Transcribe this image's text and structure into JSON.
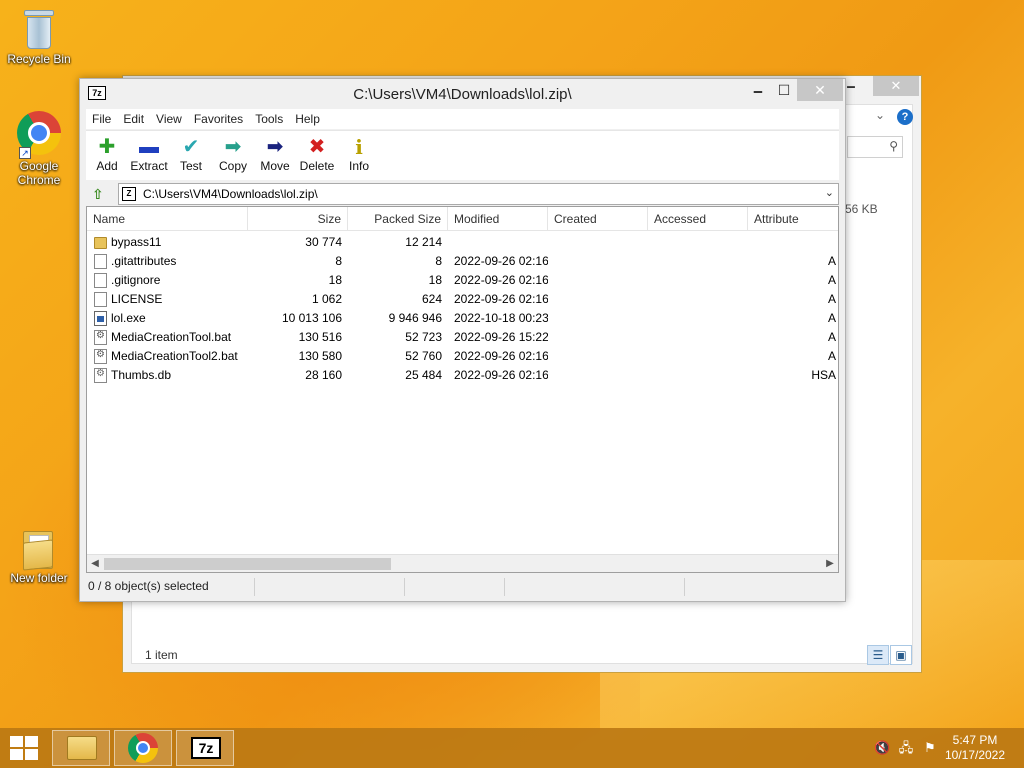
{
  "desktop": {
    "icons": [
      {
        "label": "Recycle Bin"
      },
      {
        "label": "Google Chrome"
      },
      {
        "label": "New folder"
      }
    ]
  },
  "explorer_bg": {
    "size_label": "56 KB",
    "status": "1 item",
    "help": "?"
  },
  "window": {
    "title": "C:\\Users\\VM4\\Downloads\\lol.zip\\",
    "app_icon": "7z",
    "min_glyph": "🗕",
    "max_glyph": "☐",
    "close_glyph": "✕"
  },
  "menu": [
    "File",
    "Edit",
    "View",
    "Favorites",
    "Tools",
    "Help"
  ],
  "toolbar": [
    {
      "label": "Add",
      "icon": "plus-icon",
      "glyph": "✚",
      "color": "#2ca02c"
    },
    {
      "label": "Extract",
      "icon": "minus-icon",
      "glyph": "▬",
      "color": "#1f3fbf"
    },
    {
      "label": "Test",
      "icon": "check-icon",
      "glyph": "✔",
      "color": "#2aa7b0"
    },
    {
      "label": "Copy",
      "icon": "copy-arrow-icon",
      "glyph": "➡",
      "color": "#27a08c"
    },
    {
      "label": "Move",
      "icon": "move-arrow-icon",
      "glyph": "➡",
      "color": "#1a237e"
    },
    {
      "label": "Delete",
      "icon": "delete-x-icon",
      "glyph": "✖",
      "color": "#d32020"
    },
    {
      "label": "Info",
      "icon": "info-icon",
      "glyph": "i",
      "color": "#b8a000"
    }
  ],
  "address": {
    "path": "C:\\Users\\VM4\\Downloads\\lol.zip\\"
  },
  "columns": [
    "Name",
    "Size",
    "Packed Size",
    "Modified",
    "Created",
    "Accessed",
    "Attribute"
  ],
  "files": [
    {
      "name": "bypass11",
      "type": "folder",
      "size": "30 774",
      "packed": "12 214",
      "modified": "",
      "attr": ""
    },
    {
      "name": ".gitattributes",
      "type": "file",
      "size": "8",
      "packed": "8",
      "modified": "2022-09-26 02:16",
      "attr": "A"
    },
    {
      "name": ".gitignore",
      "type": "file",
      "size": "18",
      "packed": "18",
      "modified": "2022-09-26 02:16",
      "attr": "A"
    },
    {
      "name": "LICENSE",
      "type": "file",
      "size": "1 062",
      "packed": "624",
      "modified": "2022-09-26 02:16",
      "attr": "A"
    },
    {
      "name": "lol.exe",
      "type": "exe",
      "size": "10 013 106",
      "packed": "9 946 946",
      "modified": "2022-10-18 00:23",
      "attr": "A"
    },
    {
      "name": "MediaCreationTool.bat",
      "type": "bat",
      "size": "130 516",
      "packed": "52 723",
      "modified": "2022-09-26 15:22",
      "attr": "A"
    },
    {
      "name": "MediaCreationTool2.bat",
      "type": "bat",
      "size": "130 580",
      "packed": "52 760",
      "modified": "2022-09-26 02:16",
      "attr": "A"
    },
    {
      "name": "Thumbs.db",
      "type": "db",
      "size": "28 160",
      "packed": "25 484",
      "modified": "2022-09-26 02:16",
      "attr": "HSA"
    }
  ],
  "status": "0 / 8 object(s) selected",
  "taskbar": {
    "time": "5:47 PM",
    "date": "10/17/2022"
  }
}
